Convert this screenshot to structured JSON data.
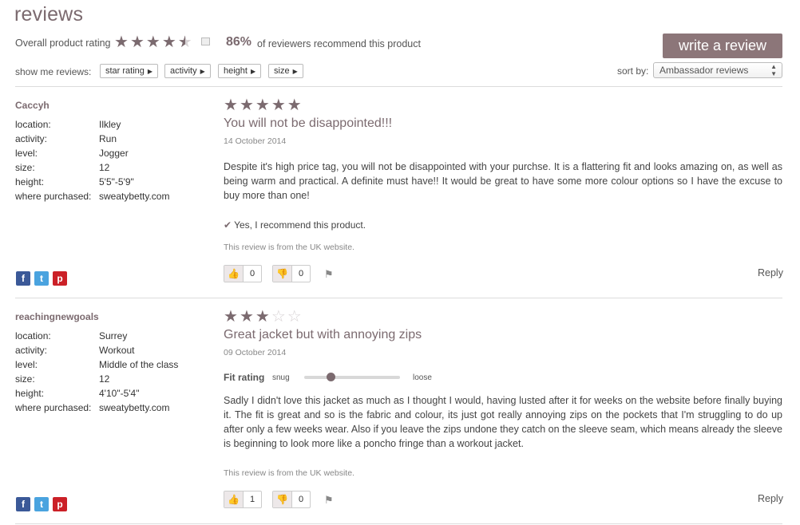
{
  "page": {
    "title": "reviews",
    "overall_label": "Overall product rating",
    "overall_rating": 4.5,
    "recommend_pct": "86%",
    "recommend_text": "of reviewers recommend this product",
    "write_review_label": "write a review"
  },
  "filters": {
    "label": "show me reviews:",
    "items": [
      {
        "label": "star rating"
      },
      {
        "label": "activity"
      },
      {
        "label": "height"
      },
      {
        "label": "size"
      }
    ]
  },
  "sort": {
    "label": "sort by:",
    "selected": "Ambassador reviews"
  },
  "attr_labels": {
    "location": "location:",
    "activity": "activity:",
    "level": "level:",
    "size": "size:",
    "height": "height:",
    "where": "where purchased:"
  },
  "reviews": [
    {
      "name": "Caccyh",
      "location": "Ilkley",
      "activity": "Run",
      "level": "Jogger",
      "size": "12",
      "height": "5'5\"-5'9\"",
      "where": "sweatybetty.com",
      "rating": 5,
      "title": "You will not be disappointed!!!",
      "date": "14 October 2014",
      "body": "Despite it's high price tag, you will not be disappointed with your purchse. It is a flattering fit and looks amazing on, as well as being warm and practical. A definite must have!! It would be great to have some more colour options so I have the excuse to buy more than one!",
      "recommend": "Yes, I recommend this product.",
      "source": "This review is from the UK website.",
      "helpful": "0",
      "unhelpful": "0",
      "reply": "Reply"
    },
    {
      "name": "reachingnewgoals",
      "location": "Surrey",
      "activity": "Workout",
      "level": "Middle of the class",
      "size": "12",
      "height": "4'10\"-5'4\"",
      "where": "sweatybetty.com",
      "rating": 3,
      "title": "Great jacket but with annoying zips",
      "date": "09 October 2014",
      "fit": {
        "label": "Fit rating",
        "min_label": "snug",
        "max_label": "loose",
        "value": 0.28
      },
      "body": "Sadly I didn't love this jacket as much as I thought I would, having lusted after it for weeks on the website before finally buying it. The fit is great and so is the fabric and colour, its just got really annoying zips on the pockets that I'm struggling to do up after only a few weeks wear. Also if you leave the zips undone they catch on the sleeve seam, which means already the sleeve is beginning to look more like a poncho fringe than a workout jacket.",
      "source": "This review is from the UK website.",
      "helpful": "1",
      "unhelpful": "0",
      "reply": "Reply"
    }
  ],
  "colors": {
    "accent": "#7b6a6f",
    "button": "#8c7679",
    "facebook": "#3b5998",
    "twitter": "#4aa3df",
    "pinterest": "#cb2027"
  }
}
